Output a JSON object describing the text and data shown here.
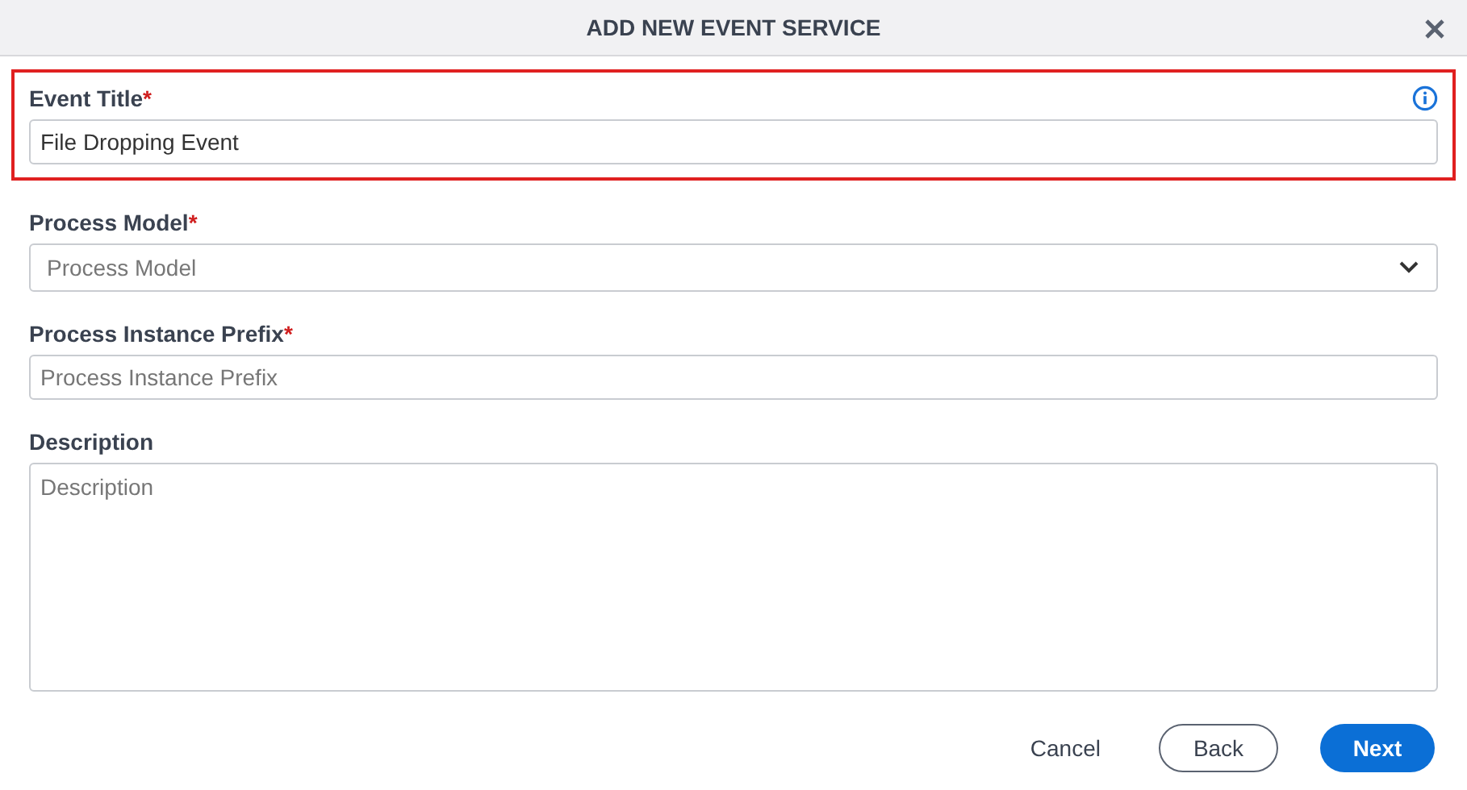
{
  "dialog": {
    "title": "ADD NEW EVENT SERVICE"
  },
  "fields": [
    {
      "kind": "text",
      "label": "Event Title",
      "required_mark": "*",
      "value": "File Dropping Event",
      "highlighted": true,
      "info": true
    },
    {
      "kind": "select",
      "label": "Process Model",
      "required_mark": "*",
      "placeholder": "Process Model",
      "highlighted": false,
      "info": false
    },
    {
      "kind": "text",
      "label": "Process Instance Prefix",
      "required_mark": "*",
      "placeholder": "Process Instance Prefix",
      "highlighted": false,
      "info": false
    },
    {
      "kind": "textarea",
      "label": "Description",
      "placeholder": "Description",
      "highlighted": false,
      "info": false
    }
  ],
  "buttons": [
    {
      "kind": "link",
      "label": "Cancel"
    },
    {
      "kind": "outline",
      "label": "Back"
    },
    {
      "kind": "primary",
      "label": "Next"
    }
  ]
}
